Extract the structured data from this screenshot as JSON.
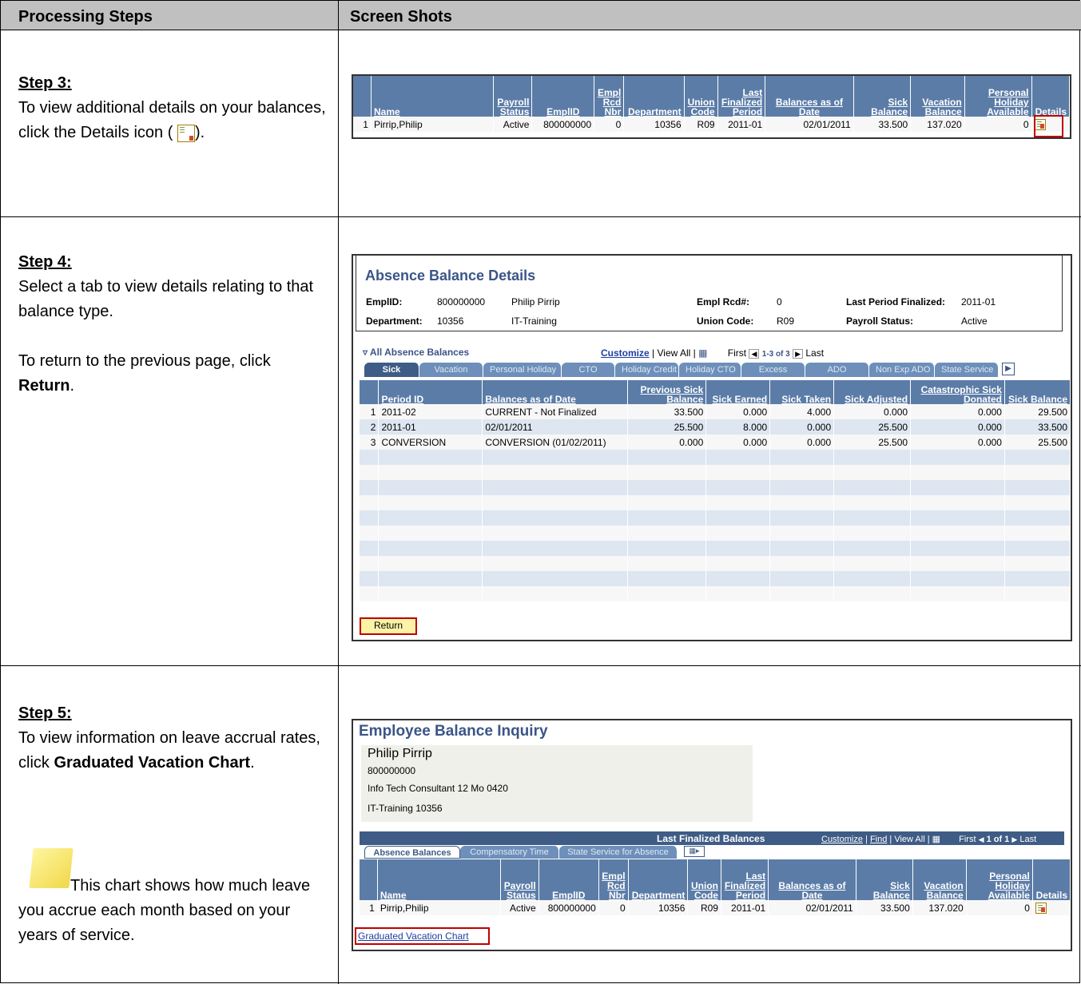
{
  "header": {
    "col1": "Processing Steps",
    "col2": "Screen Shots"
  },
  "step3": {
    "heading": "Step 3:",
    "text": "To view additional details on your balances, click the Details icon (",
    "text_end": ")."
  },
  "step4": {
    "heading": "Step 4:",
    "text": "Select a tab to view details relating to that balance type.",
    "text2_pre": "To return to the previous page, click ",
    "text2_bold": "Return",
    "text2_end": "."
  },
  "step5": {
    "heading": "Step 5:",
    "text_pre": "To view information on leave accrual rates, click ",
    "text_bold": "Graduated Vacation Chart",
    "text_end": ".",
    "note": "This chart shows how much leave you accrue each month based on your years of service."
  },
  "balances_table": {
    "headers": [
      "Name",
      "Payroll Status",
      "EmplID",
      "Empl Rcd Nbr",
      "Department",
      "Union Code",
      "Last Finalized Period",
      "Balances as of Date",
      "Sick Balance",
      "Vacation Balance",
      "Personal Holiday Available",
      "Details"
    ],
    "row": {
      "num": "1",
      "name": "Pirrip,Philip",
      "status": "Active",
      "emplid": "800000000",
      "rcd": "0",
      "dept": "10356",
      "union": "R09",
      "period": "2011-01",
      "asof": "02/01/2011",
      "sick": "33.500",
      "vacation": "137.020",
      "holiday": "0"
    },
    "details_icon": "details-icon"
  },
  "absence_details": {
    "title": "Absence Balance Details",
    "emplid_label": "EmplID:",
    "emplid": "800000000",
    "name": "Philip Pirrip",
    "rcd_label": "Empl Rcd#:",
    "rcd": "0",
    "last_label": "Last Period Finalized:",
    "last": "2011-01",
    "dept_label": "Department:",
    "dept": "10356",
    "dept_name": "IT-Training",
    "union_label": "Union Code:",
    "union": "R09",
    "status_label": "Payroll Status:",
    "status": "Active",
    "section": "All Absence Balances",
    "customize": "Customize",
    "viewall": "View All",
    "first": "First",
    "range": "1-3 of 3",
    "last_nav": "Last",
    "tabs": [
      "Sick",
      "Vacation",
      "Personal Holiday",
      "CTO",
      "Holiday Credit",
      "Holiday CTO",
      "Excess",
      "ADO",
      "Non Exp ADO",
      "State Service"
    ],
    "headers": [
      "Period ID",
      "Balances as of Date",
      "Previous Sick Balance",
      "Sick Earned",
      "Sick Taken",
      "Sick Adjusted",
      "Catastrophic Sick Donated",
      "Sick Balance"
    ],
    "rows": [
      [
        "1",
        "2011-02",
        "CURRENT - Not Finalized",
        "33.500",
        "0.000",
        "4.000",
        "0.000",
        "0.000",
        "29.500"
      ],
      [
        "2",
        "2011-01",
        "02/01/2011",
        "25.500",
        "8.000",
        "0.000",
        "25.500",
        "0.000",
        "33.500"
      ],
      [
        "3",
        "CONVERSION",
        "CONVERSION (01/02/2011)",
        "0.000",
        "0.000",
        "0.000",
        "25.500",
        "0.000",
        "25.500"
      ]
    ],
    "return": "Return"
  },
  "inquiry": {
    "title": "Employee Balance Inquiry",
    "name": "Philip Pirrip",
    "id": "800000000",
    "job": "Info Tech Consultant 12 Mo 0420",
    "dept": "IT-Training 10356",
    "grid_title": "Last Finalized Balances",
    "customize": "Customize",
    "find": "Find",
    "viewall": "View All",
    "first": "First",
    "range": "1 of 1",
    "last_nav": "Last",
    "tabs": [
      "Absence Balances",
      "Compensatory Time",
      "State Service for Absence"
    ],
    "link": "Graduated Vacation Chart"
  }
}
